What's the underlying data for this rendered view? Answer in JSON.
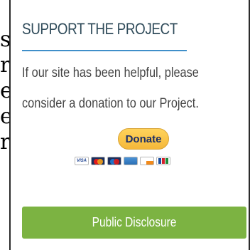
{
  "edge_glyphs": [
    "s",
    "r",
    "e",
    "e",
    "r"
  ],
  "widget": {
    "title": "SUPPORT THE PROJECT",
    "text_line1": "If our site has been helpful, please",
    "text_line2": "consider a donation to our Project.",
    "donate_label": "Donate",
    "card_icons": [
      "visa-card-icon",
      "mastercard-icon",
      "maestro-card-icon",
      "amex-card-icon",
      "discover-card-icon",
      "jcb-card-icon"
    ],
    "visa_text": "VISA",
    "disclosure_label": "Public Disclosure"
  },
  "colors": {
    "accent_underline": "#3f8fc9",
    "donate_yellow": "#f5b83a",
    "disclosure_green": "#7cb342"
  }
}
